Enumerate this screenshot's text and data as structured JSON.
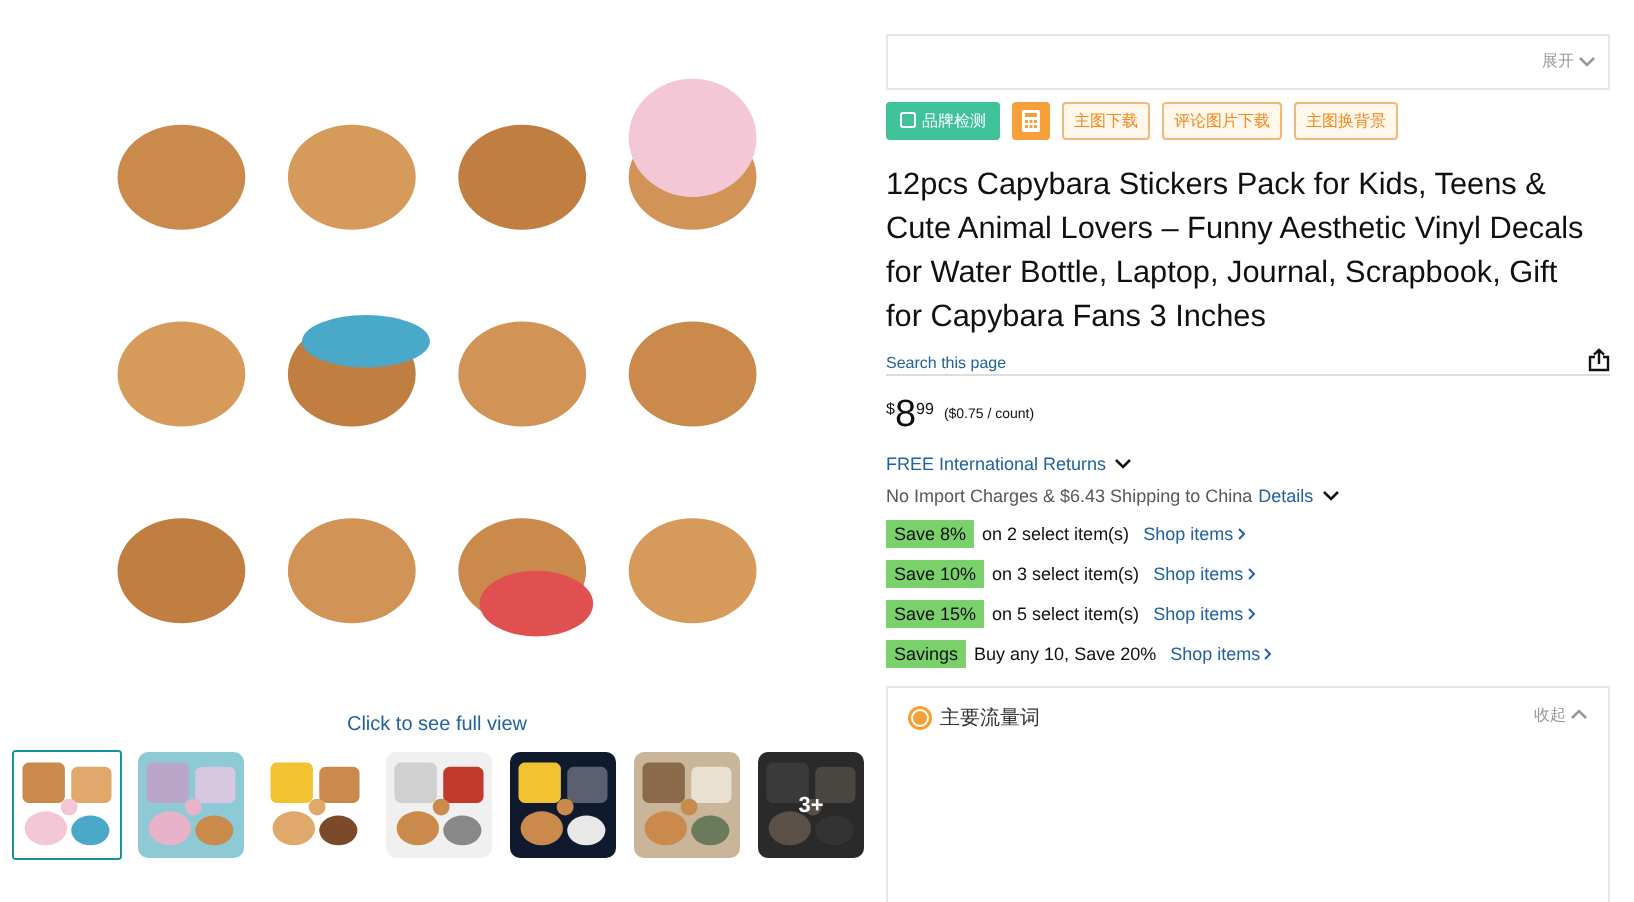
{
  "gallery": {
    "thumbnails": [
      {
        "selected": true
      },
      {
        "selected": false
      },
      {
        "selected": false
      },
      {
        "selected": false
      },
      {
        "selected": false
      },
      {
        "selected": false
      },
      {
        "selected": false,
        "overlay": "3+"
      }
    ],
    "full_view_link": "Click to see full view"
  },
  "extension_header": {
    "toggle": "展开"
  },
  "tool_buttons": [
    {
      "kind": "brand-check",
      "label": "品牌检测"
    },
    {
      "kind": "calculator"
    },
    {
      "kind": "outline",
      "label": "主图下载"
    },
    {
      "kind": "outline",
      "label": "评论图片下载"
    },
    {
      "kind": "outline",
      "label": "主图换背景"
    }
  ],
  "title": "12pcs Capybara Stickers Pack for Kids, Teens & Cute Animal Lovers – Funny Aesthetic Vinyl Decals for Water Bottle, Laptop, Journal, Scrapbook, Gift for Capybara Fans 3 Inches",
  "search_link": "Search this page",
  "price": {
    "currency": "$",
    "whole": "8",
    "fraction": "99",
    "unit_price": "($0.75 / count)"
  },
  "returns_link": "FREE International Returns",
  "shipping": {
    "text": "No Import Charges & $6.43 Shipping to China",
    "details_link": "Details"
  },
  "promotions": [
    {
      "badge": "Save 8%",
      "text": "on 2 select item(s)",
      "link": "Shop items"
    },
    {
      "badge": "Save 10%",
      "text": "on 3 select item(s)",
      "link": "Shop items"
    },
    {
      "badge": "Save 15%",
      "text": "on 5 select item(s)",
      "link": "Shop items"
    },
    {
      "badge": "Savings",
      "text": "Buy any 10, Save 20%",
      "link": "Shop items"
    }
  ],
  "keywords_panel": {
    "title": "主要流量词",
    "toggle": "收起"
  }
}
